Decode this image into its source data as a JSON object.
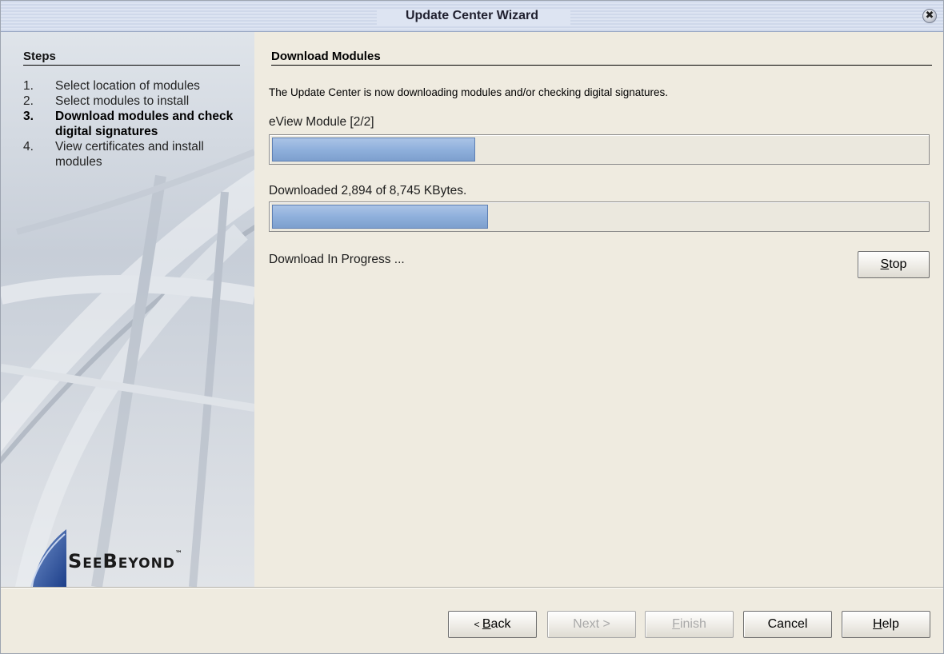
{
  "window": {
    "title": "Update Center Wizard",
    "close_glyph": "✖"
  },
  "sidebar": {
    "heading": "Steps",
    "steps": [
      {
        "num": "1.",
        "label": "Select location of modules"
      },
      {
        "num": "2.",
        "label": "Select modules to install"
      },
      {
        "num": "3.",
        "label": "Download modules and check digital signatures"
      },
      {
        "num": "4.",
        "label": "View certificates and install modules"
      }
    ],
    "current_step": 3,
    "logo": {
      "text": "SeeBeyond",
      "tm": "™"
    }
  },
  "main": {
    "title": "Download Modules",
    "description": "The Update Center is now downloading modules and/or checking digital signatures.",
    "module_label": "eView Module [2/2]",
    "module_progress": 0.31,
    "bytes_label": "Downloaded 2,894 of 8,745 KBytes.",
    "bytes_progress": 0.33,
    "status": "Download In Progress ...",
    "stop_label": {
      "mnemonic": "S",
      "rest": "top"
    }
  },
  "buttons": {
    "back": {
      "prefix": "< ",
      "mnemonic": "B",
      "rest": "ack"
    },
    "next": {
      "label": "Next >"
    },
    "finish": {
      "mnemonic": "F",
      "rest": "inish"
    },
    "cancel": {
      "label": "Cancel"
    },
    "help": {
      "mnemonic": "H",
      "rest": "elp"
    }
  },
  "colors": {
    "accent": "#8fb0dc",
    "background": "#efebe0",
    "titlebar": "#d6deee"
  }
}
